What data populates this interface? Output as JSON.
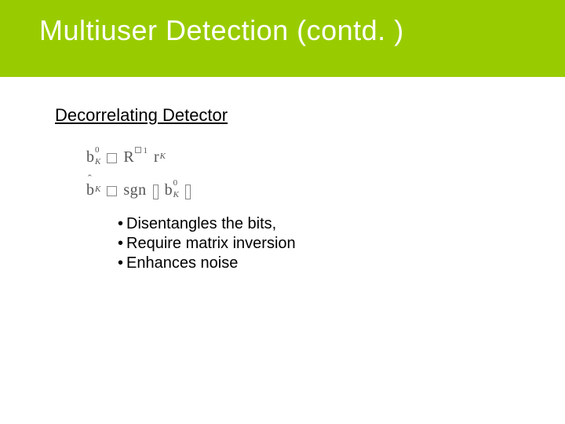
{
  "slide": {
    "title": "Multiuser Detection (contd. )",
    "section_heading": "Decorrelating Detector",
    "equations": {
      "eq1": {
        "lhs_base": "b",
        "lhs_sup": "0",
        "lhs_sub": "K",
        "r_base": "R",
        "r_sup": "1",
        "rhs_base": "r",
        "rhs_sub": "K"
      },
      "eq2": {
        "lhs_base": "b",
        "lhs_sub": "K",
        "fn": "sgn",
        "arg_base": "b",
        "arg_sup": "0",
        "arg_sub": "K"
      }
    },
    "bullets": [
      "Disentangles the bits,",
      "Require matrix inversion",
      "Enhances noise"
    ],
    "bullet_char": "•"
  }
}
